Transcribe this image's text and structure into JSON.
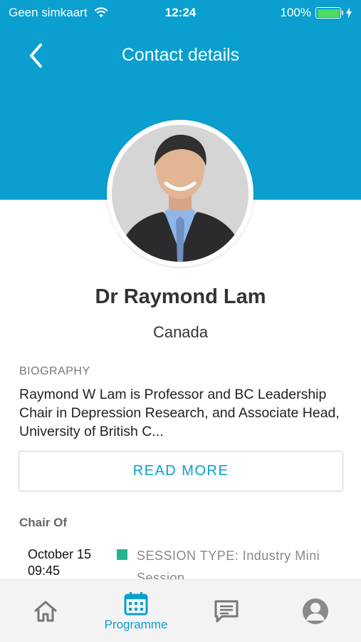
{
  "colors": {
    "accent": "#0a9fcf",
    "battery": "#4cd964",
    "session_type": "#26b391"
  },
  "status_bar": {
    "carrier": "Geen simkaart",
    "time": "12:24",
    "battery": "100%",
    "battery_level": 1.0
  },
  "nav": {
    "title": "Contact details",
    "back_icon": "chevron-left-icon"
  },
  "profile": {
    "name": "Dr Raymond Lam",
    "country": "Canada"
  },
  "biography": {
    "label": "BIOGRAPHY",
    "text": "Raymond W Lam is Professor and BC Leadership Chair in Depression Research, and Associate Head, University of British C...",
    "read_more": "READ MORE"
  },
  "chair_of": {
    "label": "Chair Of",
    "sessions": [
      {
        "date": "October 15",
        "time": "09:45",
        "type": "SESSION TYPE: Industry Mini Session"
      }
    ]
  },
  "tabs": [
    {
      "icon": "home-icon",
      "label": ""
    },
    {
      "icon": "calendar-icon",
      "label": "Programme"
    },
    {
      "icon": "chat-icon",
      "label": ""
    },
    {
      "icon": "user-icon",
      "label": ""
    }
  ]
}
